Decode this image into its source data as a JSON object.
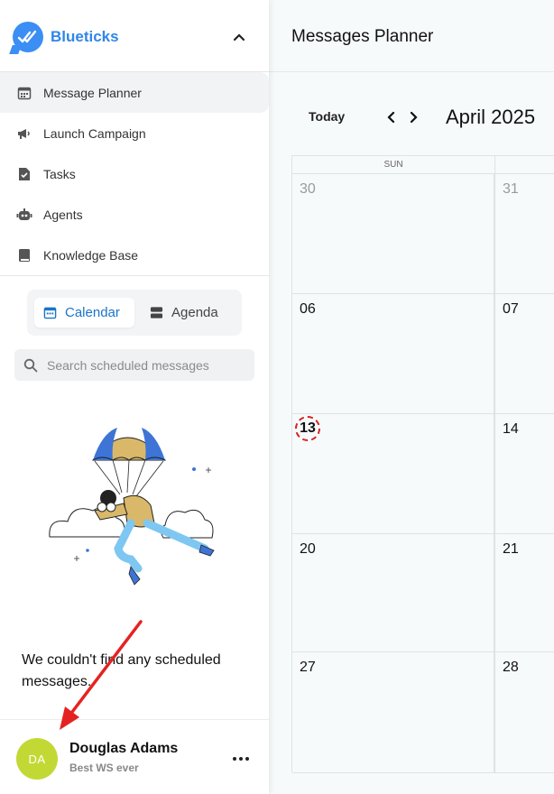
{
  "brand": {
    "name": "Blueticks",
    "accent": "#2f86e8"
  },
  "sidebar": {
    "items": [
      {
        "label": "Message Planner",
        "icon": "calendar-icon",
        "active": true
      },
      {
        "label": "Launch Campaign",
        "icon": "megaphone-icon",
        "active": false
      },
      {
        "label": "Tasks",
        "icon": "task-check-icon",
        "active": false
      },
      {
        "label": "Agents",
        "icon": "robot-icon",
        "active": false
      },
      {
        "label": "Knowledge Base",
        "icon": "book-icon",
        "active": false
      }
    ]
  },
  "view_toggle": {
    "calendar_label": "Calendar",
    "agenda_label": "Agenda",
    "selected": "Calendar"
  },
  "search": {
    "placeholder": "Search scheduled messages",
    "value": ""
  },
  "empty_state": {
    "message": "We couldn't find any scheduled messages."
  },
  "user": {
    "initials": "DA",
    "name": "Douglas Adams",
    "subtitle": "Best WS ever",
    "avatar_color": "#c2d935"
  },
  "main": {
    "title": "Messages Planner",
    "today_label": "Today",
    "month_label": "April 2025",
    "day_of_week": "SUN",
    "weeks": [
      {
        "sun": "30",
        "mon": "31",
        "sun_muted": true,
        "mon_muted": true
      },
      {
        "sun": "06",
        "mon": "07"
      },
      {
        "sun": "13",
        "mon": "14",
        "sun_today": true
      },
      {
        "sun": "20",
        "mon": "21"
      },
      {
        "sun": "27",
        "mon": "28"
      }
    ]
  },
  "annotation": {
    "arrow_color": "#e52222"
  }
}
